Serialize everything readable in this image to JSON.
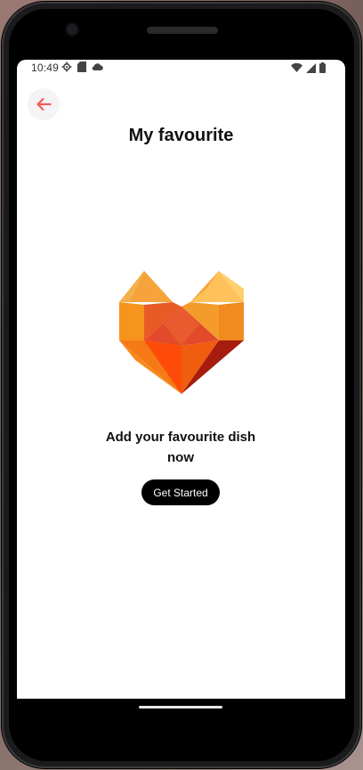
{
  "status_bar": {
    "time": "10:49"
  },
  "header": {
    "title": "My favourite",
    "back_icon": "arrow-left-icon"
  },
  "empty_state": {
    "message": "Add your favourite dish now",
    "illustration": "diamond-heart-icon"
  },
  "actions": {
    "get_started_label": "Get Started"
  },
  "colors": {
    "accent_back": "#f25c54",
    "button_bg": "#000000",
    "button_text": "#ffffff"
  }
}
